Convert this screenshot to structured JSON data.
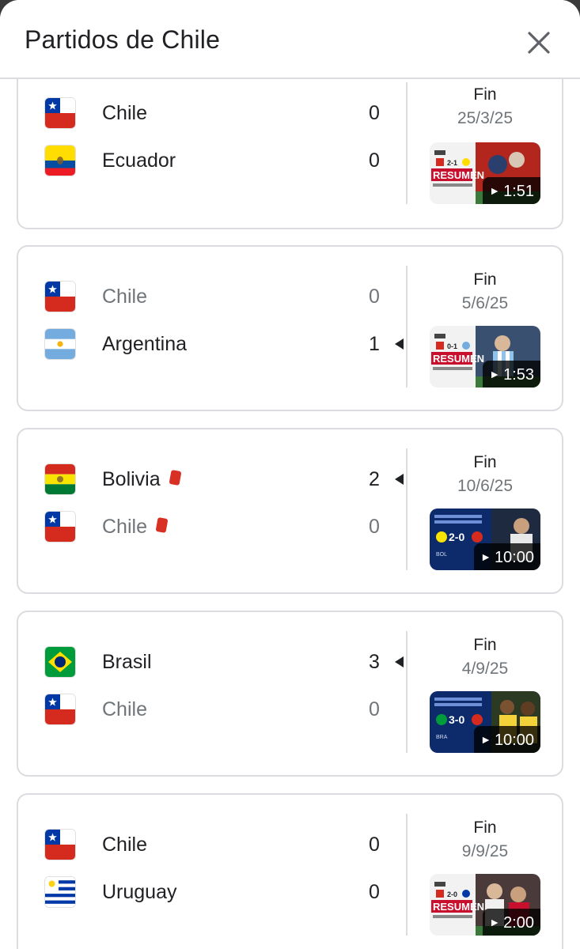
{
  "header": {
    "title": "Partidos de Chile"
  },
  "matches": [
    {
      "home": {
        "name": "Chile",
        "score": "0"
      },
      "away": {
        "name": "Ecuador",
        "score": "0"
      },
      "status": "Fin",
      "date": "25/3/25",
      "video": {
        "duration": "1:51",
        "style": "resumen",
        "badge": "RESUMEN",
        "score": "2-1"
      }
    },
    {
      "home": {
        "name": "Chile",
        "score": "0"
      },
      "away": {
        "name": "Argentina",
        "score": "1"
      },
      "status": "Fin",
      "date": "5/6/25",
      "video": {
        "duration": "1:53",
        "style": "resumen",
        "badge": "RESUMEN",
        "score": "0-1"
      }
    },
    {
      "home": {
        "name": "Bolivia",
        "score": "2"
      },
      "away": {
        "name": "Chile",
        "score": "0"
      },
      "status": "Fin",
      "date": "10/6/25",
      "video": {
        "duration": "10:00",
        "style": "blue",
        "score": "2-0",
        "abbr": "BOL"
      }
    },
    {
      "home": {
        "name": "Brasil",
        "score": "3"
      },
      "away": {
        "name": "Chile",
        "score": "0"
      },
      "status": "Fin",
      "date": "4/9/25",
      "video": {
        "duration": "10:00",
        "style": "blue",
        "score": "3-0",
        "abbr": "BRA"
      }
    },
    {
      "home": {
        "name": "Chile",
        "score": "0"
      },
      "away": {
        "name": "Uruguay",
        "score": "0"
      },
      "status": "Fin",
      "date": "9/9/25",
      "video": {
        "duration": "2:00",
        "style": "resumen",
        "badge": "RESUMEN",
        "score": "2-0"
      }
    }
  ],
  "colors": {
    "card_border": "#dadce0",
    "text_primary": "#202124",
    "text_secondary": "#70757a",
    "red_card": "#d93025"
  },
  "icons": {
    "close": "close-icon",
    "red_card": "red-card-icon",
    "winner": "winner-arrow-icon",
    "play": "play-icon"
  }
}
